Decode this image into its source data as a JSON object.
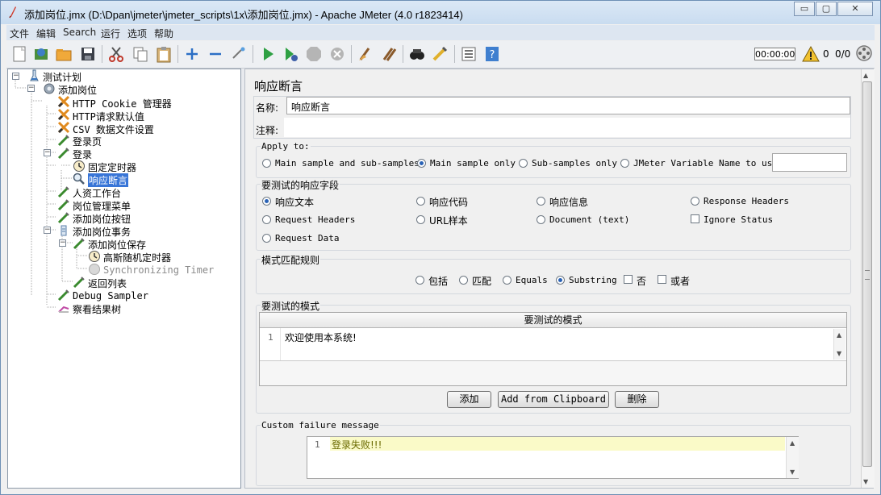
{
  "window": {
    "title": "添加岗位.jmx (D:\\Dpan\\jmeter\\jmeter_scripts\\1x\\添加岗位.jmx) - Apache JMeter (4.0 r1823414)",
    "min": "▭",
    "max": "▢",
    "close": "✕"
  },
  "menu": [
    "文件",
    "编辑",
    "Search",
    "运行",
    "选项",
    "帮助"
  ],
  "toolbar": {
    "timer": "00:00:00",
    "warning_count": "0",
    "thread_count": "0/0"
  },
  "tree": {
    "nodes": [
      {
        "label": "测试计划",
        "icon": "test-plan-icon"
      },
      {
        "label": "添加岗位",
        "icon": "thread-group-icon"
      },
      {
        "label": "HTTP Cookie 管理器",
        "icon": "config-element-icon"
      },
      {
        "label": "HTTP请求默认值",
        "icon": "config-element-icon"
      },
      {
        "label": "CSV 数据文件设置",
        "icon": "config-element-icon"
      },
      {
        "label": "登录页",
        "icon": "sampler-icon"
      },
      {
        "label": "登录",
        "icon": "sampler-icon"
      },
      {
        "label": "固定定时器",
        "icon": "timer-icon"
      },
      {
        "label": "响应断言",
        "icon": "assertion-icon"
      },
      {
        "label": "人资工作台",
        "icon": "sampler-icon"
      },
      {
        "label": "岗位管理菜单",
        "icon": "sampler-icon"
      },
      {
        "label": "添加岗位按钮",
        "icon": "sampler-icon"
      },
      {
        "label": "添加岗位事务",
        "icon": "transaction-controller-icon"
      },
      {
        "label": "添加岗位保存",
        "icon": "sampler-icon"
      },
      {
        "label": "高斯随机定时器",
        "icon": "timer-icon"
      },
      {
        "label": "Synchronizing Timer",
        "icon": "timer-icon"
      },
      {
        "label": "返回列表",
        "icon": "sampler-icon"
      },
      {
        "label": "Debug Sampler",
        "icon": "sampler-icon"
      },
      {
        "label": "察看结果树",
        "icon": "listener-icon"
      }
    ]
  },
  "panel": {
    "heading": "响应断言",
    "name_label": "名称:",
    "name_value": "响应断言",
    "comment_label": "注释:",
    "comment_value": "",
    "apply_to": {
      "title": "Apply to:",
      "options": [
        "Main sample and sub-samples",
        "Main sample only",
        "Sub-samples only",
        "JMeter Variable Name to use"
      ],
      "selected": "Main sample only",
      "variable_value": ""
    },
    "field_to_test": {
      "title": "要测试的响应字段",
      "options": [
        "响应文本",
        "响应代码",
        "响应信息",
        "Response Headers",
        "Request Headers",
        "URL样本",
        "Document (text)",
        "Request Data"
      ],
      "checkbox_ignore": "Ignore Status",
      "selected": "响应文本"
    },
    "matching_rules": {
      "title": "模式匹配规则",
      "options": [
        "包括",
        "匹配",
        "Equals",
        "Substring"
      ],
      "selected": "Substring",
      "not_label": "否",
      "or_label": "或者"
    },
    "patterns": {
      "title": "要测试的模式",
      "table_header": "要测试的模式",
      "lines": [
        "欢迎使用本系统!"
      ]
    },
    "buttons": {
      "add": "添加",
      "add_clipboard": "Add from Clipboard",
      "delete": "删除"
    },
    "failure": {
      "title": "Custom failure message",
      "lines": [
        "登录失败!!!"
      ]
    }
  },
  "colors": {
    "selection": "#3875d7",
    "highlight_line": "#fafac8"
  }
}
